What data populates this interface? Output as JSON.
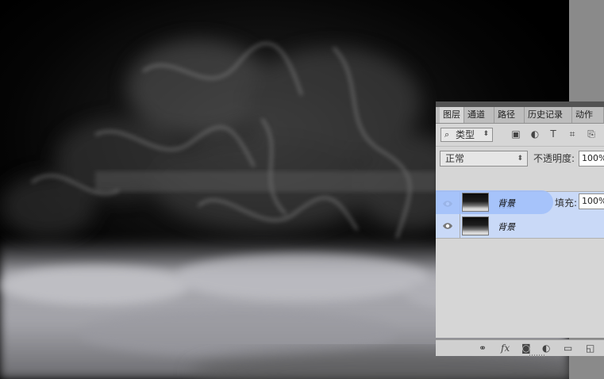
{
  "layers_panel": {
    "tabs": [
      "图层",
      "通道",
      "路径",
      "历史记录",
      "动作"
    ],
    "active_tab_index": 0,
    "filter": {
      "icon": "search-icon",
      "label": "类型"
    },
    "filter_icons": [
      "image-filter-icon",
      "adjustment-filter-icon",
      "type-filter-icon",
      "shape-filter-icon",
      "smart-object-filter-icon"
    ],
    "blend_mode": "正常",
    "opacity_label": "不透明度:",
    "opacity_value": "100%",
    "fill_label": "填充:",
    "fill_value": "100%",
    "layers": [
      {
        "name": "背景",
        "visible": true,
        "selected": true
      },
      {
        "name": "背景",
        "visible": true,
        "selected": true
      }
    ],
    "footer_icons": [
      "link-icon",
      "fx-icon",
      "mask-icon",
      "adjustment-icon",
      "folder-icon",
      "new-layer-icon"
    ],
    "footer_fx_label": "fx"
  },
  "colors": {
    "panel_bg": "#d6d6d6",
    "tab_bar": "#bdbdbd",
    "selection": "#c9d9f7",
    "workspace": "#8a8a8a"
  }
}
